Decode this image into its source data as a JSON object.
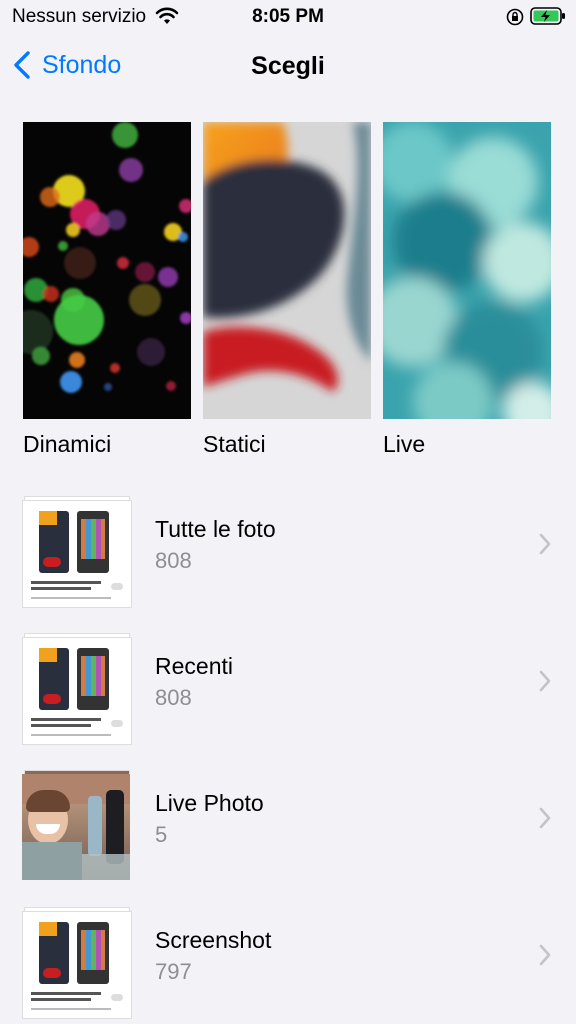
{
  "status_bar": {
    "carrier": "Nessun servizio",
    "time": "8:05 PM"
  },
  "nav": {
    "back_label": "Sfondo",
    "title": "Scegli"
  },
  "categories": [
    {
      "label": "Dinamici"
    },
    {
      "label": "Statici"
    },
    {
      "label": "Live"
    }
  ],
  "albums": [
    {
      "name": "Tutte le foto",
      "count": "808"
    },
    {
      "name": "Recenti",
      "count": "808"
    },
    {
      "name": "Live Photo",
      "count": "5"
    },
    {
      "name": "Screenshot",
      "count": "797"
    }
  ],
  "colors": {
    "accent": "#007aff",
    "background": "#f2f2f7",
    "secondary_text": "#8e8e93",
    "battery_green": "#34c759"
  },
  "icons": [
    "wifi-icon",
    "orientation-lock-icon",
    "battery-charging-icon",
    "chevron-left-icon",
    "chevron-right-icon"
  ]
}
